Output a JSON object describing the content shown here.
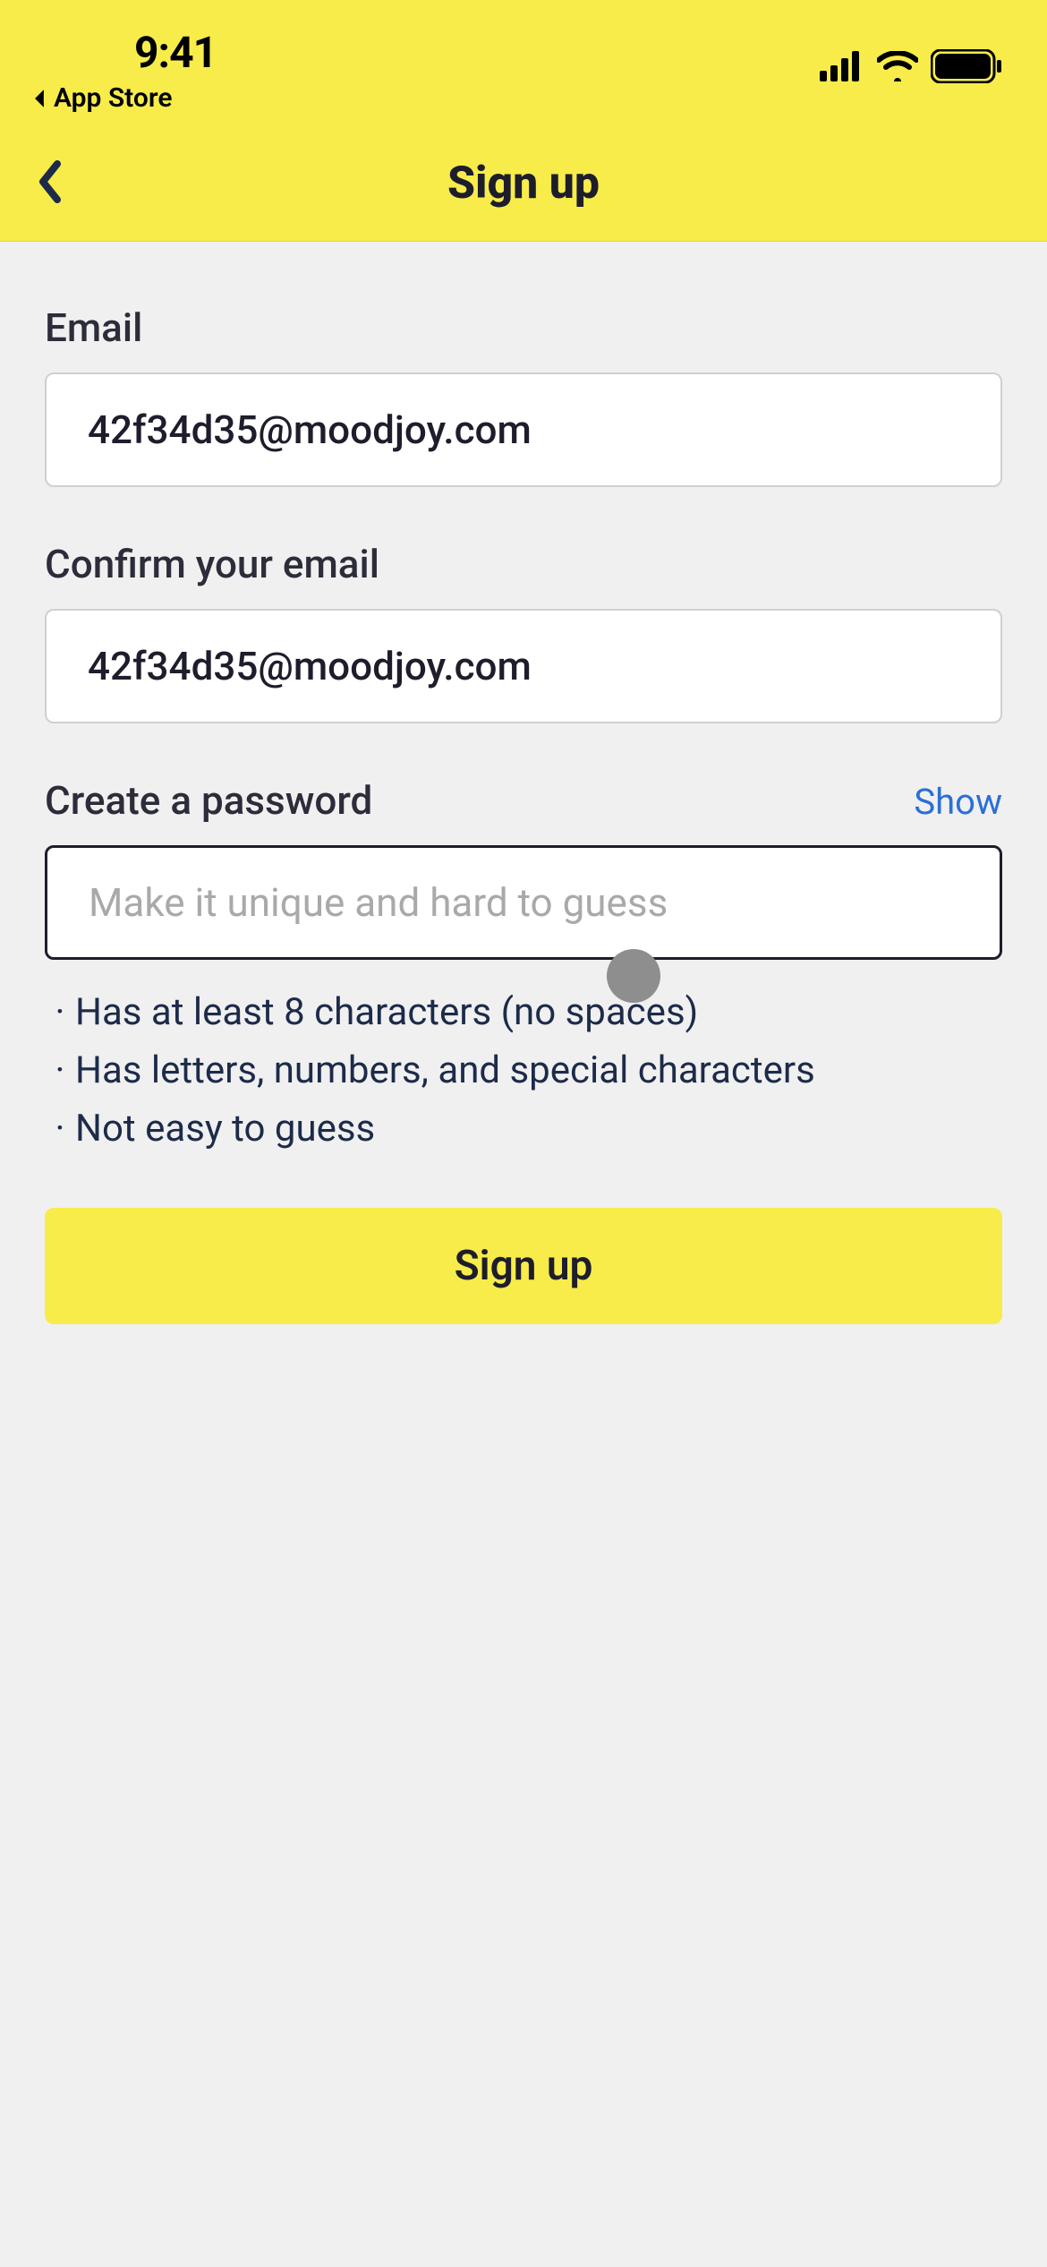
{
  "statusbar": {
    "time": "9:41",
    "back_to_app": "App Store"
  },
  "header": {
    "title": "Sign up"
  },
  "form": {
    "email_label": "Email",
    "email_value": "42f34d35@moodjoy.com",
    "confirm_label": "Confirm your email",
    "confirm_value": "42f34d35@moodjoy.com",
    "password_label": "Create a password",
    "password_show": "Show",
    "password_placeholder": "Make it unique and hard to guess",
    "password_value": "",
    "requirements": [
      "Has at least 8 characters (no spaces)",
      "Has letters, numbers, and special characters",
      "Not easy to guess"
    ],
    "submit_label": "Sign up"
  }
}
